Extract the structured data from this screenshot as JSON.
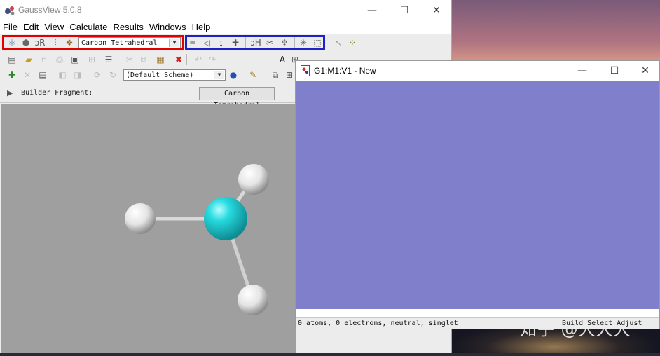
{
  "app": {
    "title": "GaussView 5.0.8"
  },
  "window_controls": {
    "minimize": "—",
    "maximize": "☐",
    "close": "✕"
  },
  "menu": [
    "File",
    "Edit",
    "View",
    "Calculate",
    "Results",
    "Windows",
    "Help"
  ],
  "toolbar": {
    "fragment_selected": "Carbon Tetrahedral",
    "scheme_selected": "(Default Scheme)"
  },
  "builder": {
    "label": "Builder Fragment:",
    "fragment_button": "Carbon Tetrahedral"
  },
  "view_window": {
    "title": "G1:M1:V1 - New",
    "status": "0 atoms, 0 electrons, neutral, singlet",
    "status_right": "Build Select Adjust"
  },
  "watermark": "知乎 @大大大",
  "colors": {
    "highlight_red": "#e00000",
    "highlight_blue": "#1d21c8",
    "carbon": "#22d3d9",
    "hydrogen": "#eeeeee",
    "viewport_bg": "#9f9f9f",
    "view_canvas_bg": "#7f7fcc"
  }
}
